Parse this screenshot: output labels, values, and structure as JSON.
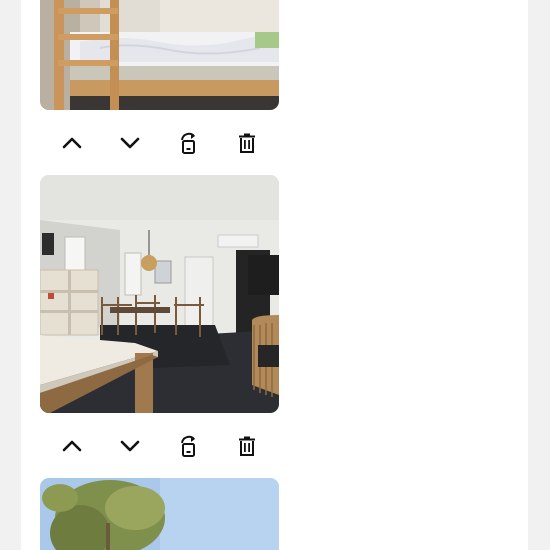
{
  "colors": {
    "page_background": "#f1f1f1",
    "panel_background": "#ffffff",
    "icon_color": "#111111"
  },
  "photos": [
    {
      "subject": "bunk-bed-photo",
      "toolbar_icons": [
        "chevron-up-icon",
        "chevron-down-icon",
        "rotate-icon",
        "trash-icon"
      ]
    },
    {
      "subject": "living-room-photo",
      "toolbar_icons": [
        "chevron-up-icon",
        "chevron-down-icon",
        "rotate-icon",
        "trash-icon"
      ]
    },
    {
      "subject": "trees-sky-photo"
    }
  ]
}
